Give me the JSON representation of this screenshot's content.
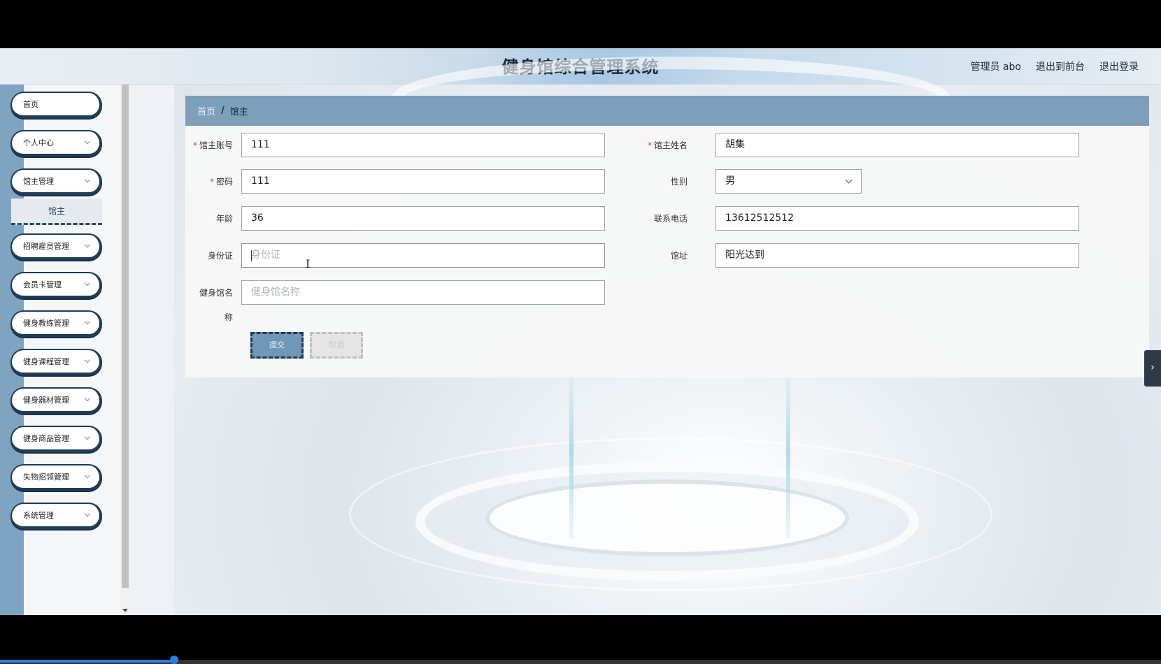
{
  "header": {
    "title": "健身馆综合管理系统",
    "admin_label": "管理员 abo",
    "to_frontend": "退出到前台",
    "logout": "退出登录"
  },
  "sidebar": {
    "items": [
      {
        "label": "首页",
        "has_chevron": false
      },
      {
        "label": "个人中心",
        "has_chevron": true
      },
      {
        "label": "馆主管理",
        "has_chevron": true
      },
      {
        "label": "招聘雇员管理",
        "has_chevron": true
      },
      {
        "label": "会员卡管理",
        "has_chevron": true
      },
      {
        "label": "健身教练管理",
        "has_chevron": true
      },
      {
        "label": "健身课程管理",
        "has_chevron": true
      },
      {
        "label": "健身器材管理",
        "has_chevron": true
      },
      {
        "label": "健身商品管理",
        "has_chevron": true
      },
      {
        "label": "失物招领管理",
        "has_chevron": true
      },
      {
        "label": "系统管理",
        "has_chevron": true
      }
    ],
    "submenu_active": "馆主"
  },
  "breadcrumb": {
    "home": "首页",
    "separator": "/",
    "current": "馆主"
  },
  "form": {
    "account": {
      "label": "馆主账号",
      "required": true,
      "value": "111"
    },
    "password": {
      "label": "密码",
      "required": true,
      "value": "111"
    },
    "age": {
      "label": "年龄",
      "required": false,
      "value": "36"
    },
    "id_card": {
      "label": "身份证",
      "required": false,
      "value": "",
      "placeholder": "身份证"
    },
    "gym_name": {
      "label_line1": "健身馆名",
      "label_line2": "称",
      "required": false,
      "value": "",
      "placeholder": "健身馆名称"
    },
    "owner_name": {
      "label": "馆主姓名",
      "required": true,
      "value": "胡集"
    },
    "gender": {
      "label": "性别",
      "required": false,
      "value": "男"
    },
    "phone": {
      "label": "联系电话",
      "required": false,
      "value": "13612512512"
    },
    "address": {
      "label": "馆址",
      "required": false,
      "value": "阳光达到"
    },
    "submit_label": "提交",
    "cancel_label": "取消"
  },
  "colors": {
    "accent": "#7c9fba",
    "sidebar_rail": "#7fa4c2",
    "menu_border": "#1f3d57",
    "required": "#e0443a"
  }
}
